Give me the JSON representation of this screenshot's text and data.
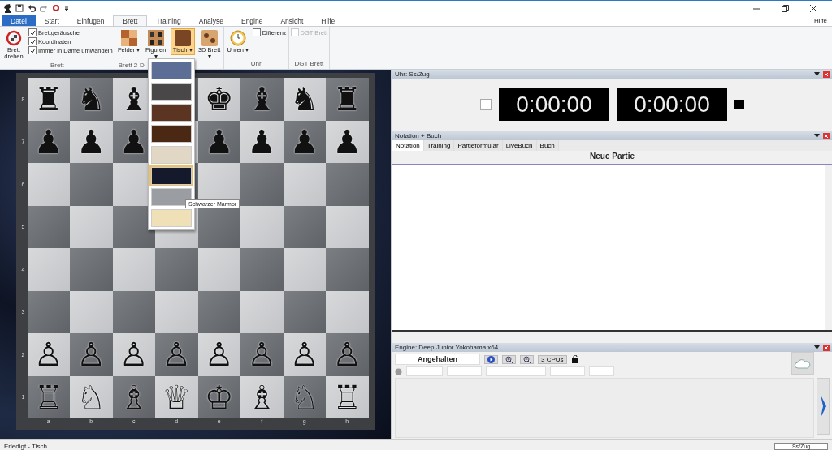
{
  "ribbon": {
    "tabs": [
      {
        "label": "Datei",
        "selected": false,
        "kind": "file"
      },
      {
        "label": "Start",
        "selected": false,
        "kind": "tab"
      },
      {
        "label": "Einfügen",
        "selected": false,
        "kind": "tab"
      },
      {
        "label": "Brett",
        "selected": true,
        "kind": "tab"
      },
      {
        "label": "Training",
        "selected": false,
        "kind": "tab"
      },
      {
        "label": "Analyse",
        "selected": false,
        "kind": "tab"
      },
      {
        "label": "Engine",
        "selected": false,
        "kind": "tab"
      },
      {
        "label": "Ansicht",
        "selected": false,
        "kind": "tab"
      },
      {
        "label": "Hilfe",
        "selected": false,
        "kind": "tab"
      }
    ],
    "help_link": "Hilfe",
    "groups": [
      {
        "label": "Brett",
        "items": [
          {
            "kind": "big",
            "label": "Brett drehen",
            "selected": false
          },
          {
            "kind": "checks",
            "checks": [
              {
                "label": "Brettgeräusche",
                "checked": true,
                "disabled": false
              },
              {
                "label": "Koordinaten",
                "checked": true,
                "disabled": false
              },
              {
                "label": "Immer in Dame umwandeln",
                "checked": true,
                "disabled": false
              }
            ]
          }
        ]
      },
      {
        "label": "Brett 2-D",
        "items": [
          {
            "kind": "big",
            "label": "Felder",
            "selected": false,
            "arrow": "▾"
          },
          {
            "kind": "big",
            "label": "Figuren",
            "selected": false,
            "arrow": "▾"
          },
          {
            "kind": "big",
            "label": "Tisch",
            "selected": true,
            "arrow": "▾"
          },
          {
            "kind": "big",
            "label": "3D Brett",
            "selected": false,
            "arrow": "▾"
          }
        ]
      },
      {
        "label": "Uhr",
        "items": [
          {
            "kind": "big",
            "label": "Uhren",
            "selected": false,
            "arrow": "▾"
          },
          {
            "kind": "checks",
            "checks": [
              {
                "label": "Differenz",
                "checked": false,
                "disabled": false
              }
            ]
          }
        ]
      },
      {
        "label": "DGT Brett",
        "items": [
          {
            "kind": "checks",
            "checks": [
              {
                "label": "DGT Brett",
                "checked": false,
                "disabled": true
              }
            ]
          }
        ]
      }
    ]
  },
  "table_menu": {
    "swatches": [
      {
        "color": "#5d6e96",
        "selected": false
      },
      {
        "color": "#4a4749",
        "selected": false
      },
      {
        "color": "#5b3422",
        "selected": false
      },
      {
        "color": "#4a2814",
        "selected": false
      },
      {
        "color": "#e2d6c4",
        "selected": false
      },
      {
        "color": "#141a2b",
        "selected": true
      },
      {
        "color": "#9a9ea3",
        "selected": false
      },
      {
        "color": "#efe0b8",
        "selected": false
      }
    ],
    "tooltip": "Schwarzer Marmor"
  },
  "board": {
    "ranks": [
      {
        "label": "8",
        "squares": [
          {
            "kind": "light",
            "piece": "♜"
          },
          {
            "kind": "dark",
            "piece": "♞"
          },
          {
            "kind": "light",
            "piece": "♝"
          },
          {
            "kind": "dark"
          },
          {
            "kind": "light",
            "piece": "♚"
          },
          {
            "kind": "dark",
            "piece": "♝"
          },
          {
            "kind": "light",
            "piece": "♞"
          },
          {
            "kind": "dark",
            "piece": "♜"
          }
        ]
      },
      {
        "label": "7",
        "squares": [
          {
            "kind": "dark",
            "piece": "♟"
          },
          {
            "kind": "light",
            "piece": "♟"
          },
          {
            "kind": "dark",
            "piece": "♟"
          },
          {
            "kind": "light"
          },
          {
            "kind": "dark",
            "piece": "♟"
          },
          {
            "kind": "light",
            "piece": "♟"
          },
          {
            "kind": "dark",
            "piece": "♟"
          },
          {
            "kind": "light",
            "piece": "♟"
          }
        ]
      },
      {
        "label": "6",
        "squares": [
          {
            "kind": "light"
          },
          {
            "kind": "dark"
          },
          {
            "kind": "light"
          },
          {
            "kind": "dark"
          },
          {
            "kind": "light"
          },
          {
            "kind": "dark"
          },
          {
            "kind": "light"
          },
          {
            "kind": "dark"
          }
        ]
      },
      {
        "label": "5",
        "squares": [
          {
            "kind": "dark"
          },
          {
            "kind": "light"
          },
          {
            "kind": "dark"
          },
          {
            "kind": "light"
          },
          {
            "kind": "dark"
          },
          {
            "kind": "light"
          },
          {
            "kind": "dark"
          },
          {
            "kind": "light"
          }
        ]
      },
      {
        "label": "4",
        "squares": [
          {
            "kind": "light"
          },
          {
            "kind": "dark"
          },
          {
            "kind": "light"
          },
          {
            "kind": "dark"
          },
          {
            "kind": "light"
          },
          {
            "kind": "dark"
          },
          {
            "kind": "light"
          },
          {
            "kind": "dark"
          }
        ]
      },
      {
        "label": "3",
        "squares": [
          {
            "kind": "dark"
          },
          {
            "kind": "light"
          },
          {
            "kind": "dark"
          },
          {
            "kind": "light"
          },
          {
            "kind": "dark"
          },
          {
            "kind": "light"
          },
          {
            "kind": "dark"
          },
          {
            "kind": "light"
          }
        ]
      },
      {
        "label": "2",
        "squares": [
          {
            "kind": "light",
            "piece": "♙"
          },
          {
            "kind": "dark",
            "piece": "♙"
          },
          {
            "kind": "light",
            "piece": "♙"
          },
          {
            "kind": "dark",
            "piece": "♙"
          },
          {
            "kind": "light",
            "piece": "♙"
          },
          {
            "kind": "dark",
            "piece": "♙"
          },
          {
            "kind": "light",
            "piece": "♙"
          },
          {
            "kind": "dark",
            "piece": "♙"
          }
        ]
      },
      {
        "label": "1",
        "squares": [
          {
            "kind": "dark",
            "piece": "♖"
          },
          {
            "kind": "light",
            "piece": "♘"
          },
          {
            "kind": "dark",
            "piece": "♗"
          },
          {
            "kind": "light",
            "piece": "♕"
          },
          {
            "kind": "dark",
            "piece": "♔"
          },
          {
            "kind": "light",
            "piece": "♗"
          },
          {
            "kind": "dark",
            "piece": "♘"
          },
          {
            "kind": "light",
            "piece": "♖"
          }
        ]
      }
    ],
    "files": [
      "a",
      "b",
      "c",
      "d",
      "e",
      "f",
      "g",
      "h"
    ]
  },
  "clock_panel": {
    "title": "Uhr: Ss/Zug",
    "clocks": [
      "0:00:00",
      "0:00:00"
    ]
  },
  "notation_panel": {
    "title": "Notation + Buch",
    "tabs": [
      {
        "label": "Notation",
        "selected": true
      },
      {
        "label": "Training",
        "selected": false
      },
      {
        "label": "Partieformular",
        "selected": false
      },
      {
        "label": "LiveBuch",
        "selected": false
      },
      {
        "label": "Buch",
        "selected": false
      }
    ],
    "heading": "Neue Partie"
  },
  "engine_panel": {
    "title": "Engine: Deep Junior Yokohama x64",
    "status": "Angehalten",
    "cpus": "3 CPUs"
  },
  "status_bar": {
    "text": "Erledigt - Tisch",
    "right": "Ss/Zug"
  }
}
